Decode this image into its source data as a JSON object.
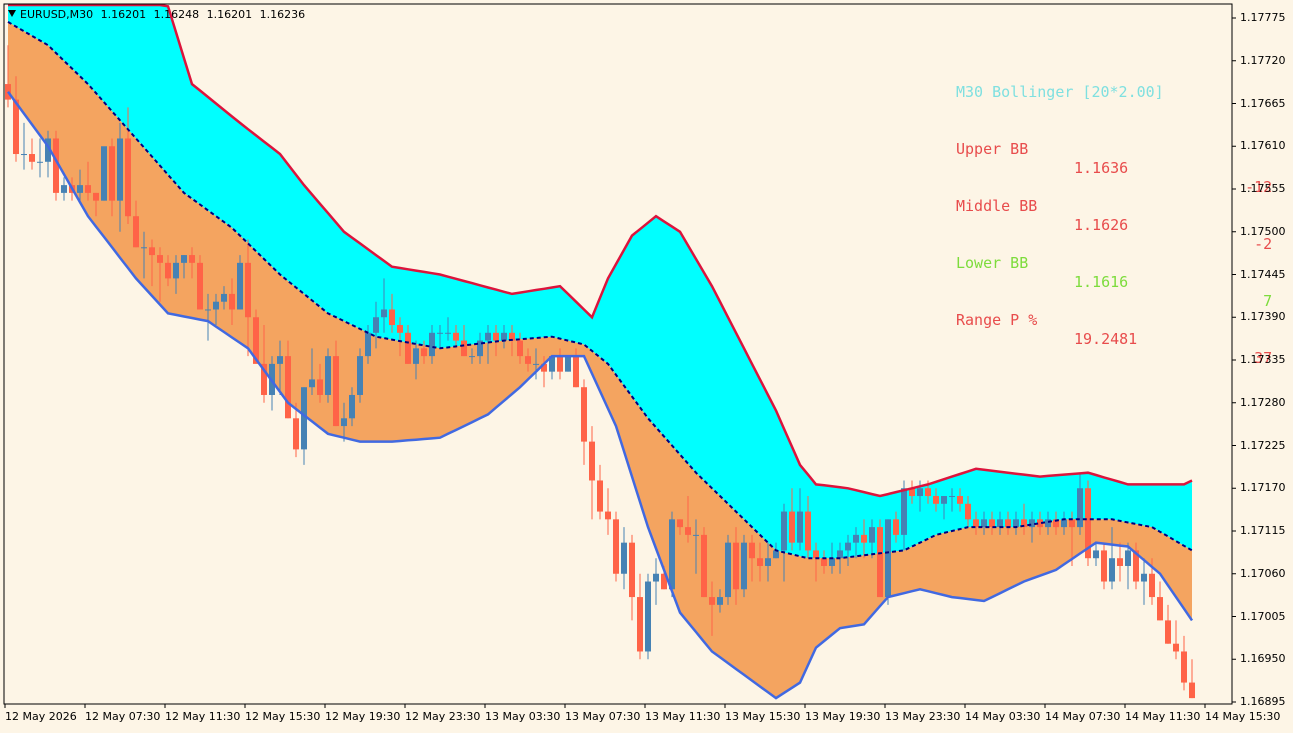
{
  "header": {
    "symbol": "EURUSD,M30",
    "ohlc": [
      "1.16201",
      "1.16248",
      "1.16201",
      "1.16236"
    ]
  },
  "indicator_panel": {
    "title": "M30 Bollinger [20*2.00]",
    "rows": [
      {
        "name": "Upper BB",
        "value": "1.1636",
        "points": "-12",
        "color": "#e84c4c"
      },
      {
        "name": "Middle BB",
        "value": "1.1626",
        "points": "-2",
        "color": "#e84c4c"
      },
      {
        "name": "Lower BB",
        "value": "1.1616",
        "points": "7",
        "color": "#7ddc3c"
      },
      {
        "name": "Range P %",
        "value": "19.2481",
        "points": "37",
        "color": "#e84c4c"
      }
    ],
    "title_color": "#7fe0e0"
  },
  "colors": {
    "background": "#fdf5e6",
    "upper_band_fill": "#00ffff",
    "lower_band_fill": "#f4a460",
    "upper_band_line": "#dc143c",
    "lower_band_line": "#4169e1",
    "middle_band_line": "#000080",
    "bull_candle": "#4682b4",
    "bear_candle": "#ff6347"
  },
  "price_axis": [
    "1.17775",
    "1.17720",
    "1.17665",
    "1.17610",
    "1.17555",
    "1.17500",
    "1.17445",
    "1.17390",
    "1.17335",
    "1.17280",
    "1.17225",
    "1.17170",
    "1.17115",
    "1.17060",
    "1.17005",
    "1.16950",
    "1.16895"
  ],
  "time_axis": [
    "12 May 2026",
    "12 May 07:30",
    "12 May 11:30",
    "12 May 15:30",
    "12 May 19:30",
    "12 May 23:30",
    "13 May 03:30",
    "13 May 07:30",
    "13 May 11:30",
    "13 May 15:30",
    "13 May 19:30",
    "13 May 23:30",
    "14 May 03:30",
    "14 May 07:30",
    "14 May 11:30",
    "14 May 15:30"
  ],
  "chart_data": {
    "type": "candlestick",
    "title": "EURUSD,M30",
    "bar_interval_minutes": 30,
    "y_range": [
      1.1689,
      1.1779
    ],
    "bollinger": {
      "period": 20,
      "deviation": 2.0,
      "upper_points": [
        [
          0,
          1.1786
        ],
        [
          20,
          1.1779
        ],
        [
          23,
          1.1769
        ],
        [
          29,
          1.1764
        ],
        [
          34,
          1.176
        ],
        [
          37,
          1.1756
        ],
        [
          42,
          1.175
        ],
        [
          48,
          1.17455
        ],
        [
          54,
          1.17445
        ],
        [
          63,
          1.1742
        ],
        [
          69,
          1.1743
        ],
        [
          73,
          1.1739
        ],
        [
          75,
          1.1744
        ],
        [
          78,
          1.17495
        ],
        [
          81,
          1.1752
        ],
        [
          84,
          1.175
        ],
        [
          88,
          1.1743
        ],
        [
          92,
          1.1735
        ],
        [
          96,
          1.1727
        ],
        [
          99,
          1.172
        ],
        [
          101,
          1.17175
        ],
        [
          105,
          1.1717
        ],
        [
          109,
          1.1716
        ],
        [
          115,
          1.17175
        ],
        [
          121,
          1.17195
        ],
        [
          129,
          1.17185
        ],
        [
          135,
          1.1719
        ],
        [
          140,
          1.17175
        ],
        [
          147,
          1.17175
        ],
        [
          149,
          1.17185
        ],
        [
          152,
          1.1721
        ]
      ],
      "middle_points": [
        [
          0,
          1.1777
        ],
        [
          5,
          1.1774
        ],
        [
          10,
          1.1769
        ],
        [
          16,
          1.1762
        ],
        [
          22,
          1.1755
        ],
        [
          28,
          1.17505
        ],
        [
          34,
          1.17445
        ],
        [
          40,
          1.17395
        ],
        [
          46,
          1.17365
        ],
        [
          54,
          1.1735
        ],
        [
          62,
          1.1736
        ],
        [
          68,
          1.17365
        ],
        [
          72,
          1.17355
        ],
        [
          75,
          1.1733
        ],
        [
          80,
          1.1726
        ],
        [
          86,
          1.1719
        ],
        [
          92,
          1.1713
        ],
        [
          96,
          1.1709
        ],
        [
          100,
          1.1708
        ],
        [
          104,
          1.1708
        ],
        [
          108,
          1.17085
        ],
        [
          112,
          1.1709
        ],
        [
          116,
          1.1711
        ],
        [
          120,
          1.1712
        ],
        [
          126,
          1.1712
        ],
        [
          132,
          1.1713
        ],
        [
          138,
          1.1713
        ],
        [
          143,
          1.1712
        ],
        [
          148,
          1.1709
        ],
        [
          152,
          1.17065
        ]
      ],
      "lower_points": [
        [
          0,
          1.1768
        ],
        [
          5,
          1.1761
        ],
        [
          10,
          1.1752
        ],
        [
          16,
          1.1744
        ],
        [
          20,
          1.17395
        ],
        [
          25,
          1.17385
        ],
        [
          30,
          1.1735
        ],
        [
          35,
          1.1728
        ],
        [
          40,
          1.1724
        ],
        [
          44,
          1.1723
        ],
        [
          48,
          1.1723
        ],
        [
          54,
          1.17235
        ],
        [
          60,
          1.17265
        ],
        [
          64,
          1.173
        ],
        [
          68,
          1.1734
        ],
        [
          72,
          1.1734
        ],
        [
          76,
          1.1725
        ],
        [
          80,
          1.1712
        ],
        [
          84,
          1.1701
        ],
        [
          88,
          1.1696
        ],
        [
          92,
          1.1693
        ],
        [
          96,
          1.169
        ],
        [
          99,
          1.1692
        ],
        [
          101,
          1.16965
        ],
        [
          104,
          1.1699
        ],
        [
          107,
          1.16995
        ],
        [
          110,
          1.1703
        ],
        [
          114,
          1.1704
        ],
        [
          118,
          1.1703
        ],
        [
          122,
          1.17025
        ],
        [
          127,
          1.1705
        ],
        [
          131,
          1.17065
        ],
        [
          136,
          1.171
        ],
        [
          140,
          1.17095
        ],
        [
          144,
          1.1706
        ],
        [
          148,
          1.17
        ],
        [
          152,
          1.1694
        ]
      ]
    },
    "candles": [
      [
        1.1769,
        1.1774,
        1.1766,
        1.1767
      ],
      [
        1.1767,
        1.177,
        1.1759,
        1.176
      ],
      [
        1.176,
        1.1764,
        1.1758,
        1.176
      ],
      [
        1.176,
        1.1762,
        1.1758,
        1.1759
      ],
      [
        1.1759,
        1.1762,
        1.1757,
        1.1759
      ],
      [
        1.1759,
        1.1763,
        1.1757,
        1.1762
      ],
      [
        1.1762,
        1.1763,
        1.1754,
        1.1755
      ],
      [
        1.1755,
        1.1757,
        1.1754,
        1.1756
      ],
      [
        1.1756,
        1.1757,
        1.1754,
        1.1755
      ],
      [
        1.1755,
        1.1758,
        1.1754,
        1.1756
      ],
      [
        1.1756,
        1.1759,
        1.1754,
        1.1755
      ],
      [
        1.1755,
        1.1755,
        1.1752,
        1.1754
      ],
      [
        1.1754,
        1.176,
        1.1754,
        1.1761
      ],
      [
        1.1761,
        1.1762,
        1.1752,
        1.1754
      ],
      [
        1.1754,
        1.1764,
        1.175,
        1.1762
      ],
      [
        1.1762,
        1.1766,
        1.1751,
        1.1752
      ],
      [
        1.1752,
        1.1754,
        1.1748,
        1.1748
      ],
      [
        1.1748,
        1.175,
        1.1744,
        1.1748
      ],
      [
        1.1748,
        1.1749,
        1.1743,
        1.1747
      ],
      [
        1.1747,
        1.1748,
        1.1741,
        1.1746
      ],
      [
        1.1746,
        1.1747,
        1.1743,
        1.1744
      ],
      [
        1.1744,
        1.1747,
        1.1742,
        1.1746
      ],
      [
        1.1746,
        1.1747,
        1.1744,
        1.1747
      ],
      [
        1.1747,
        1.1748,
        1.1744,
        1.1746
      ],
      [
        1.1746,
        1.1747,
        1.174,
        1.174
      ],
      [
        1.174,
        1.1742,
        1.1736,
        1.174
      ],
      [
        1.174,
        1.1742,
        1.1738,
        1.1741
      ],
      [
        1.1741,
        1.1743,
        1.174,
        1.1742
      ],
      [
        1.1742,
        1.1744,
        1.1738,
        1.174
      ],
      [
        1.174,
        1.1747,
        1.174,
        1.1746
      ],
      [
        1.1746,
        1.1749,
        1.1734,
        1.1739
      ],
      [
        1.1739,
        1.174,
        1.1734,
        1.1733
      ],
      [
        1.1733,
        1.1738,
        1.1728,
        1.1729
      ],
      [
        1.1729,
        1.1734,
        1.1727,
        1.1733
      ],
      [
        1.1733,
        1.1736,
        1.1729,
        1.1734
      ],
      [
        1.1734,
        1.1736,
        1.1726,
        1.1726
      ],
      [
        1.1726,
        1.1728,
        1.1721,
        1.1722
      ],
      [
        1.1722,
        1.173,
        1.172,
        1.173
      ],
      [
        1.173,
        1.1735,
        1.1729,
        1.1731
      ],
      [
        1.1731,
        1.1733,
        1.1728,
        1.1729
      ],
      [
        1.1729,
        1.1735,
        1.1728,
        1.1734
      ],
      [
        1.1734,
        1.1736,
        1.1725,
        1.1725
      ],
      [
        1.1725,
        1.1728,
        1.1723,
        1.1726
      ],
      [
        1.1726,
        1.173,
        1.1725,
        1.1729
      ],
      [
        1.1729,
        1.1735,
        1.1728,
        1.1734
      ],
      [
        1.1734,
        1.1738,
        1.1733,
        1.1737
      ],
      [
        1.1737,
        1.1741,
        1.1735,
        1.1739
      ],
      [
        1.1739,
        1.1744,
        1.1737,
        1.174
      ],
      [
        1.174,
        1.1742,
        1.1737,
        1.1738
      ],
      [
        1.1738,
        1.1739,
        1.1734,
        1.1737
      ],
      [
        1.1737,
        1.1738,
        1.1733,
        1.1733
      ],
      [
        1.1733,
        1.1736,
        1.1731,
        1.1735
      ],
      [
        1.1735,
        1.1736,
        1.1733,
        1.1734
      ],
      [
        1.1734,
        1.1738,
        1.1733,
        1.1737
      ],
      [
        1.1737,
        1.1738,
        1.1735,
        1.1737
      ],
      [
        1.1737,
        1.1739,
        1.1736,
        1.1737
      ],
      [
        1.1737,
        1.1738,
        1.1735,
        1.1736
      ],
      [
        1.1736,
        1.1738,
        1.1734,
        1.1734
      ],
      [
        1.1734,
        1.1735,
        1.1733,
        1.1734
      ],
      [
        1.1734,
        1.1737,
        1.1733,
        1.1736
      ],
      [
        1.1736,
        1.1738,
        1.1733,
        1.1737
      ],
      [
        1.1737,
        1.1738,
        1.1734,
        1.1736
      ],
      [
        1.1736,
        1.1738,
        1.1735,
        1.1737
      ],
      [
        1.1737,
        1.1738,
        1.1734,
        1.1736
      ],
      [
        1.1736,
        1.1737,
        1.1733,
        1.1734
      ],
      [
        1.1734,
        1.1735,
        1.1732,
        1.1733
      ],
      [
        1.1733,
        1.1735,
        1.1731,
        1.1733
      ],
      [
        1.1733,
        1.1734,
        1.173,
        1.1732
      ],
      [
        1.1732,
        1.1734,
        1.1731,
        1.1734
      ],
      [
        1.1734,
        1.1735,
        1.1731,
        1.1732
      ],
      [
        1.1732,
        1.1734,
        1.1732,
        1.1734
      ],
      [
        1.1734,
        1.1735,
        1.173,
        1.173
      ],
      [
        1.173,
        1.1731,
        1.172,
        1.1723
      ],
      [
        1.1723,
        1.1725,
        1.1713,
        1.1718
      ],
      [
        1.1718,
        1.172,
        1.1713,
        1.1714
      ],
      [
        1.1714,
        1.1717,
        1.1711,
        1.1713
      ],
      [
        1.1713,
        1.1714,
        1.1705,
        1.1706
      ],
      [
        1.1706,
        1.1712,
        1.1704,
        1.171
      ],
      [
        1.171,
        1.1711,
        1.17,
        1.1703
      ],
      [
        1.1703,
        1.1706,
        1.1695,
        1.1696
      ],
      [
        1.1696,
        1.1706,
        1.1695,
        1.1705
      ],
      [
        1.1705,
        1.1708,
        1.1702,
        1.1706
      ],
      [
        1.1706,
        1.1707,
        1.1704,
        1.1704
      ],
      [
        1.1704,
        1.1714,
        1.1703,
        1.1713
      ],
      [
        1.1713,
        1.1713,
        1.1711,
        1.1712
      ],
      [
        1.1712,
        1.1716,
        1.171,
        1.1711
      ],
      [
        1.1711,
        1.1713,
        1.1706,
        1.1711
      ],
      [
        1.1711,
        1.1712,
        1.1703,
        1.1703
      ],
      [
        1.1703,
        1.1705,
        1.1698,
        1.1702
      ],
      [
        1.1702,
        1.1704,
        1.1701,
        1.1703
      ],
      [
        1.1703,
        1.1711,
        1.1702,
        1.171
      ],
      [
        1.171,
        1.1712,
        1.1702,
        1.1704
      ],
      [
        1.1704,
        1.1711,
        1.1703,
        1.171
      ],
      [
        1.171,
        1.1711,
        1.1705,
        1.1708
      ],
      [
        1.1708,
        1.171,
        1.1705,
        1.1707
      ],
      [
        1.1707,
        1.171,
        1.1705,
        1.1708
      ],
      [
        1.1708,
        1.171,
        1.1708,
        1.1709
      ],
      [
        1.1709,
        1.1715,
        1.1705,
        1.1714
      ],
      [
        1.1714,
        1.1717,
        1.1709,
        1.171
      ],
      [
        1.171,
        1.1717,
        1.1709,
        1.1714
      ],
      [
        1.1714,
        1.1716,
        1.1708,
        1.1709
      ],
      [
        1.1709,
        1.171,
        1.1705,
        1.1708
      ],
      [
        1.1708,
        1.1709,
        1.1706,
        1.1707
      ],
      [
        1.1707,
        1.171,
        1.1706,
        1.1708
      ],
      [
        1.1708,
        1.171,
        1.1706,
        1.1709
      ],
      [
        1.1709,
        1.1711,
        1.1707,
        1.171
      ],
      [
        1.171,
        1.1712,
        1.1708,
        1.1711
      ],
      [
        1.1711,
        1.1713,
        1.1708,
        1.171
      ],
      [
        1.171,
        1.1713,
        1.1708,
        1.1712
      ],
      [
        1.1712,
        1.1713,
        1.1708,
        1.1703
      ],
      [
        1.1703,
        1.1713,
        1.1702,
        1.1713
      ],
      [
        1.1713,
        1.1714,
        1.171,
        1.1711
      ],
      [
        1.1711,
        1.1718,
        1.1709,
        1.1717
      ],
      [
        1.1717,
        1.1718,
        1.1715,
        1.1716
      ],
      [
        1.1716,
        1.1718,
        1.1714,
        1.1717
      ],
      [
        1.1717,
        1.1718,
        1.1715,
        1.1716
      ],
      [
        1.1716,
        1.1717,
        1.1714,
        1.1715
      ],
      [
        1.1715,
        1.1716,
        1.1713,
        1.1716
      ],
      [
        1.1716,
        1.1717,
        1.1714,
        1.1716
      ],
      [
        1.1716,
        1.1717,
        1.1714,
        1.1715
      ],
      [
        1.1715,
        1.1716,
        1.1712,
        1.1713
      ],
      [
        1.1713,
        1.1714,
        1.1711,
        1.1712
      ],
      [
        1.1712,
        1.1714,
        1.1711,
        1.1713
      ],
      [
        1.1713,
        1.1714,
        1.1711,
        1.1712
      ],
      [
        1.1712,
        1.1714,
        1.1711,
        1.1713
      ],
      [
        1.1713,
        1.1714,
        1.1711,
        1.1712
      ],
      [
        1.1712,
        1.1714,
        1.1711,
        1.1713
      ],
      [
        1.1713,
        1.1715,
        1.1711,
        1.1712
      ],
      [
        1.1712,
        1.1714,
        1.171,
        1.1713
      ],
      [
        1.1713,
        1.1714,
        1.1711,
        1.1712
      ],
      [
        1.1712,
        1.1714,
        1.1711,
        1.1713
      ],
      [
        1.1713,
        1.1714,
        1.1711,
        1.1712
      ],
      [
        1.1712,
        1.1714,
        1.1711,
        1.1713
      ],
      [
        1.1713,
        1.1714,
        1.1707,
        1.1712
      ],
      [
        1.1712,
        1.1719,
        1.1711,
        1.1717
      ],
      [
        1.1717,
        1.1718,
        1.1707,
        1.1708
      ],
      [
        1.1708,
        1.171,
        1.1707,
        1.1709
      ],
      [
        1.1709,
        1.171,
        1.1704,
        1.1705
      ],
      [
        1.1705,
        1.1712,
        1.1704,
        1.1708
      ],
      [
        1.1708,
        1.171,
        1.1705,
        1.1707
      ],
      [
        1.1707,
        1.171,
        1.1704,
        1.1709
      ],
      [
        1.1709,
        1.171,
        1.1704,
        1.1705
      ],
      [
        1.1705,
        1.1708,
        1.1702,
        1.1706
      ],
      [
        1.1706,
        1.1708,
        1.1702,
        1.1703
      ],
      [
        1.1703,
        1.1705,
        1.17,
        1.17
      ],
      [
        1.17,
        1.1702,
        1.1697,
        1.1697
      ],
      [
        1.1697,
        1.17,
        1.1695,
        1.1696
      ],
      [
        1.1696,
        1.1698,
        1.1691,
        1.1692
      ],
      [
        1.1692,
        1.1695,
        1.169,
        1.169
      ]
    ]
  }
}
